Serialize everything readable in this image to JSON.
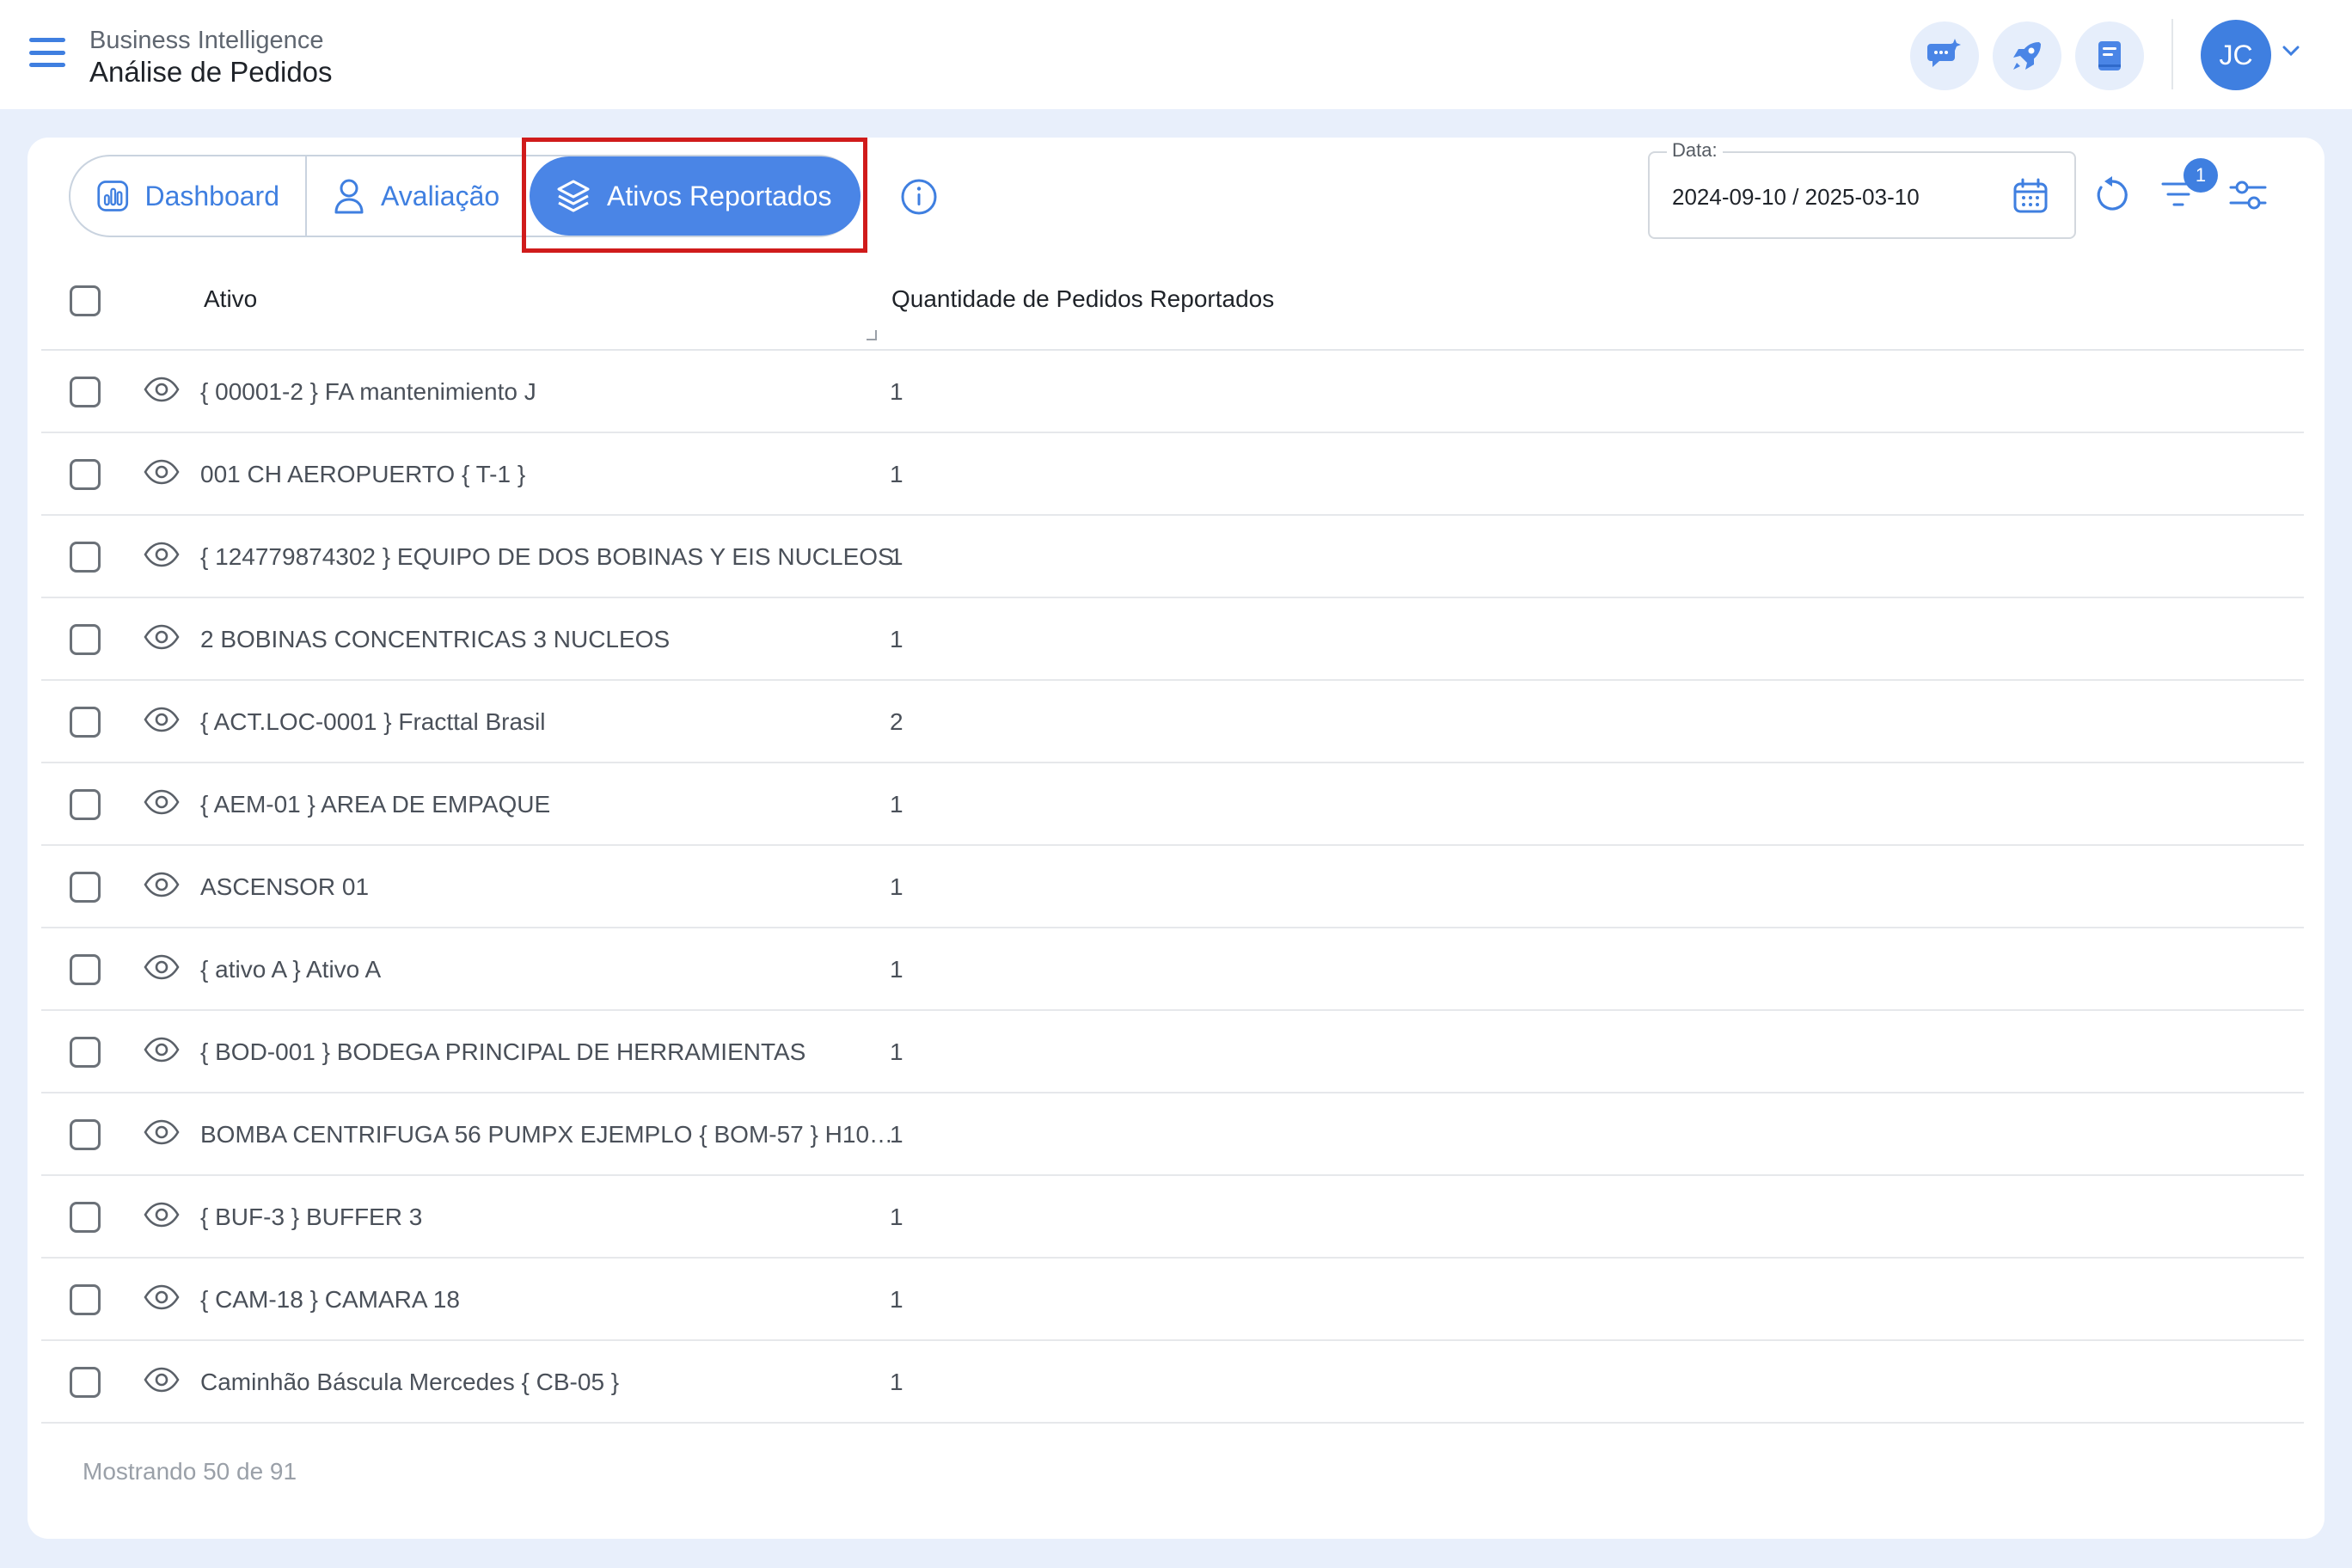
{
  "header": {
    "subtitle": "Business Intelligence",
    "title": "Análise de Pedidos",
    "avatar_initials": "JC",
    "icons": [
      "chat-sparkle-icon",
      "rocket-icon",
      "book-icon"
    ]
  },
  "tabs": [
    {
      "label": "Dashboard",
      "icon": "chart-bars-icon"
    },
    {
      "label": "Avaliação",
      "icon": "user-icon"
    },
    {
      "label": "Ativos Reportados",
      "icon": "layers-icon",
      "active": true
    }
  ],
  "date_filter": {
    "label": "Data:",
    "value": "2024-09-10 / 2025-03-10"
  },
  "filter_badge_count": "1",
  "table": {
    "columns": [
      "Ativo",
      "Quantidade de Pedidos Reportados"
    ],
    "rows": [
      {
        "name": "{ 00001-2 } FA mantenimiento J",
        "qty": "1"
      },
      {
        "name": "001 CH AEROPUERTO { T-1 }",
        "qty": "1"
      },
      {
        "name": "{ 124779874302 } EQUIPO DE DOS BOBINAS Y EIS NUCLEOS",
        "qty": "1"
      },
      {
        "name": "2 BOBINAS CONCENTRICAS 3 NUCLEOS",
        "qty": "1"
      },
      {
        "name": "{ ACT.LOC-0001 } Fracttal Brasil",
        "qty": "2"
      },
      {
        "name": "{ AEM-01 } AREA DE EMPAQUE",
        "qty": "1"
      },
      {
        "name": "ASCENSOR 01",
        "qty": "1"
      },
      {
        "name": "{ ativo A } Ativo A",
        "qty": "1"
      },
      {
        "name": "{ BOD-001 } BODEGA PRINCIPAL DE HERRAMIENTAS",
        "qty": "1"
      },
      {
        "name": "BOMBA CENTRIFUGA 56 PUMPX EJEMPLO { BOM-57 } H10…",
        "qty": "1"
      },
      {
        "name": "{ BUF-3 } BUFFER 3",
        "qty": "1"
      },
      {
        "name": "{ CAM-18 } CAMARA 18",
        "qty": "1"
      },
      {
        "name": "Caminhão Báscula Mercedes { CB-05 }",
        "qty": "1"
      }
    ]
  },
  "footer": {
    "showing": "Mostrando 50 de 91"
  },
  "colors": {
    "accent": "#3f7fe0",
    "active_tab": "#4a85e6",
    "highlight": "#d01b1b",
    "background": "#e8effb"
  }
}
